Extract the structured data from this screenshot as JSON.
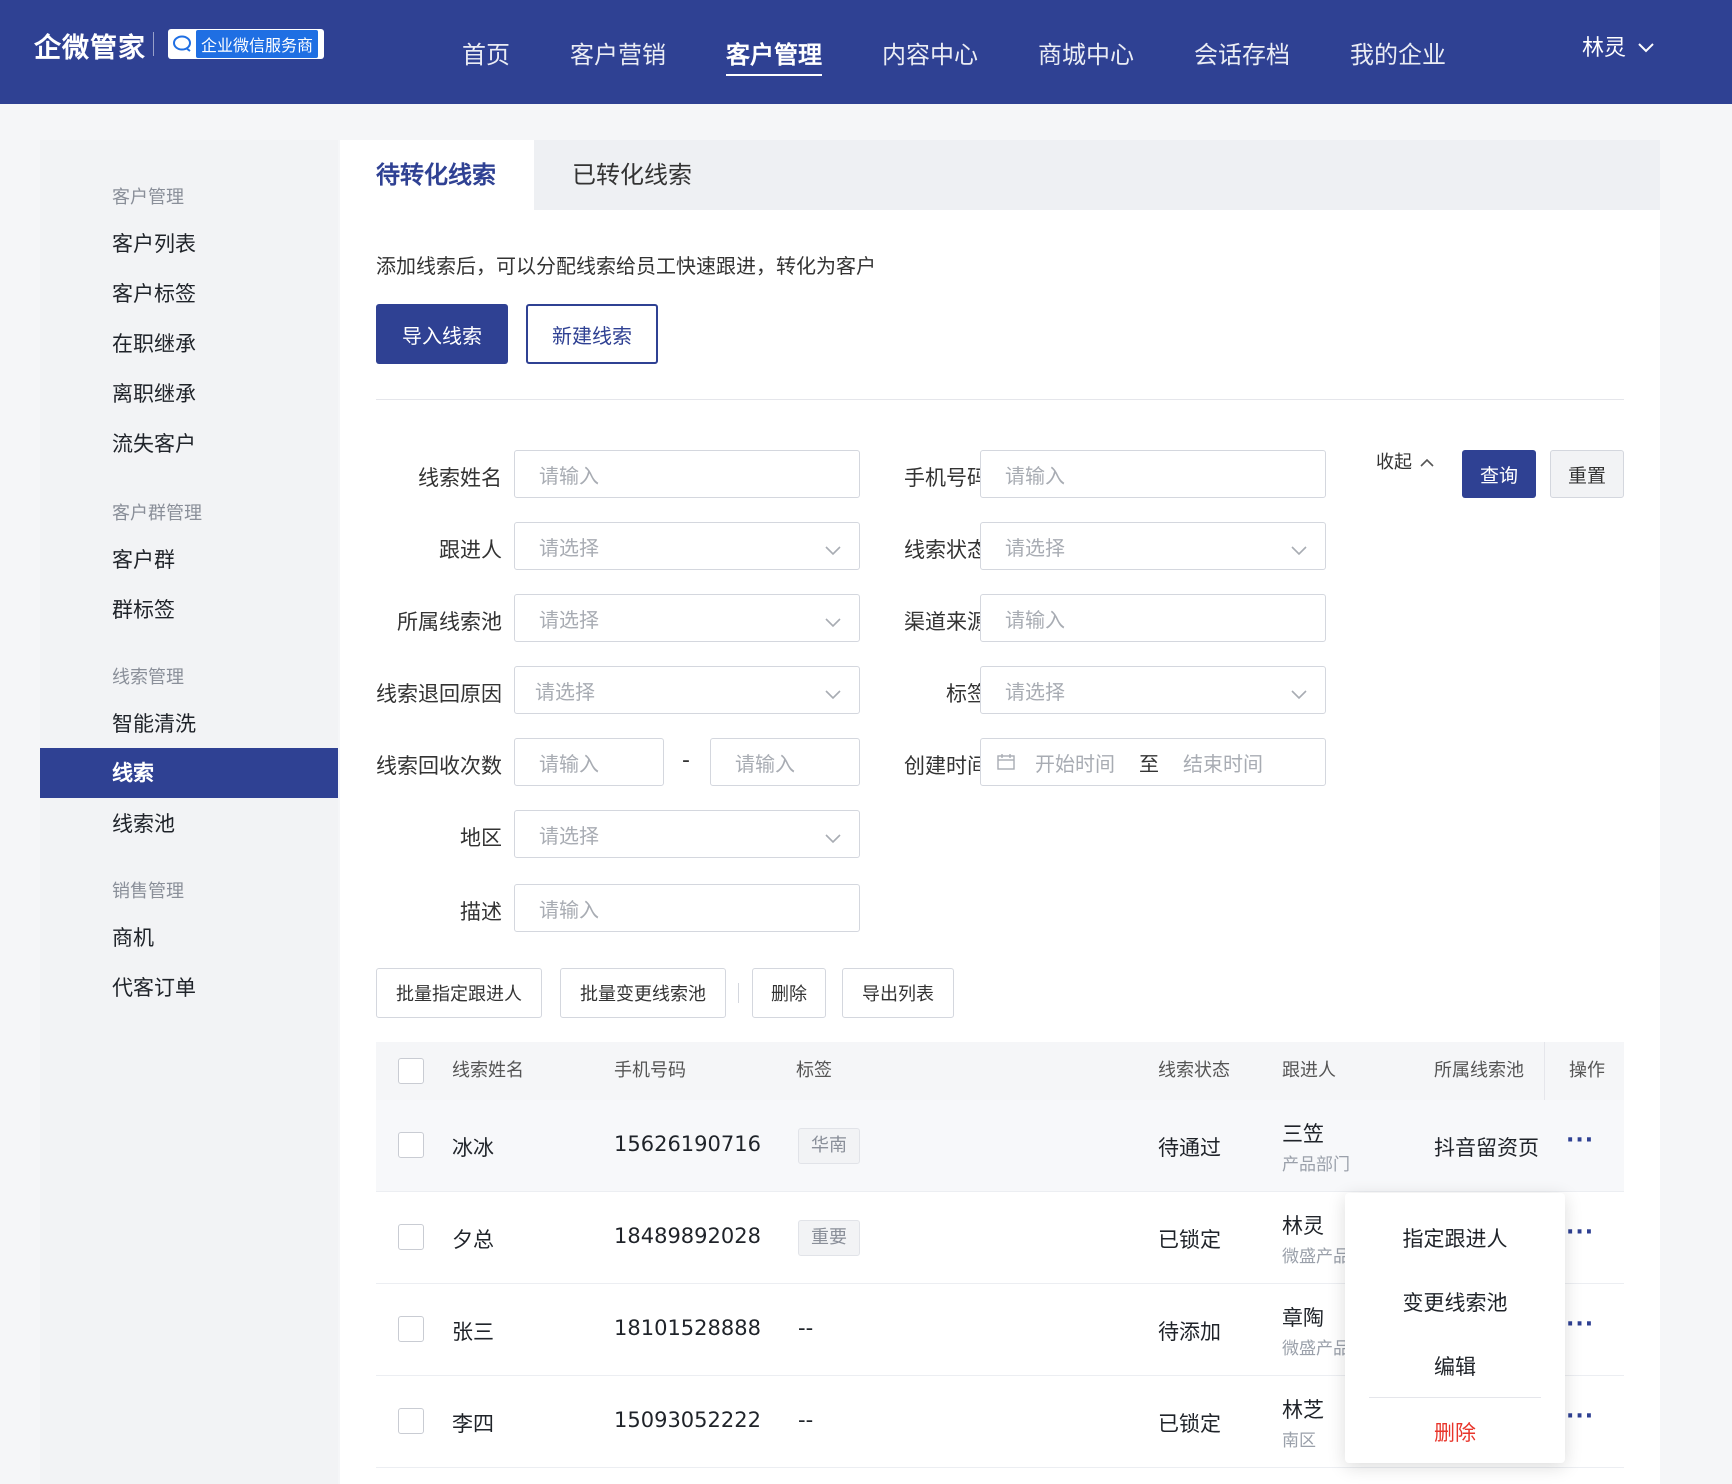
{
  "header": {
    "logo": "企微管家",
    "partner_badge": "企业微信服务商",
    "nav": [
      "首页",
      "客户营销",
      "客户管理",
      "内容中心",
      "商城中心",
      "会话存档",
      "我的企业"
    ],
    "active_nav": "客户管理",
    "user": "林灵"
  },
  "sidebar": {
    "groups": [
      {
        "title": "客户管理",
        "items": [
          "客户列表",
          "客户标签",
          "在职继承",
          "离职继承",
          "流失客户"
        ]
      },
      {
        "title": "客户群管理",
        "items": [
          "客户群",
          "群标签"
        ]
      },
      {
        "title": "线索管理",
        "items": [
          "智能清洗",
          "线索",
          "线索池"
        ]
      },
      {
        "title": "销售管理",
        "items": [
          "商机",
          "代客订单"
        ]
      }
    ],
    "active_item": "线索"
  },
  "tabs": [
    "待转化线索",
    "已转化线索"
  ],
  "description": "添加线索后，可以分配线索给员工快速跟进，转化为客户",
  "buttons": {
    "import": "导入线索",
    "create": "新建线索"
  },
  "filters": {
    "name": {
      "label": "线索姓名",
      "placeholder": "请输入"
    },
    "phone": {
      "label": "手机号码",
      "placeholder": "请输入"
    },
    "follower": {
      "label": "跟进人",
      "placeholder": "请选择"
    },
    "status": {
      "label": "线索状态",
      "placeholder": "请选择"
    },
    "pool": {
      "label": "所属线索池",
      "placeholder": "请选择"
    },
    "channel": {
      "label": "渠道来源",
      "placeholder": "请输入"
    },
    "return_reason": {
      "label": "线索退回原因",
      "placeholder": "请选择"
    },
    "tag": {
      "label": "标签",
      "placeholder": "请选择"
    },
    "recycle_count": {
      "label": "线索回收次数",
      "min_placeholder": "请输入",
      "sep": "-",
      "max_placeholder": "请输入"
    },
    "created": {
      "label": "创建时间",
      "start": "开始时间",
      "to": "至",
      "end": "结束时间"
    },
    "region": {
      "label": "地区",
      "placeholder": "请选择"
    },
    "desc": {
      "label": "描述",
      "placeholder": "请输入"
    },
    "collapse": "收起",
    "query": "查询",
    "reset": "重置"
  },
  "actions": [
    "批量指定跟进人",
    "批量变更线索池",
    "删除",
    "导出列表"
  ],
  "table": {
    "columns": [
      "线索姓名",
      "手机号码",
      "标签",
      "线索状态",
      "跟进人",
      "所属线索池",
      "操作"
    ],
    "rows": [
      {
        "name": "冰冰",
        "phone": "15626190716",
        "tag": "华南",
        "status": "待通过",
        "follower": "三笠",
        "dept": "产品部门",
        "pool": "抖音留资页"
      },
      {
        "name": "夕总",
        "phone": "18489892028",
        "tag": "重要",
        "status": "已锁定",
        "follower": "林灵",
        "dept": "微盛产品",
        "pool": ""
      },
      {
        "name": "张三",
        "phone": "18101528888",
        "tag": "--",
        "status": "待添加",
        "follower": "章陶",
        "dept": "微盛产品",
        "pool": ""
      },
      {
        "name": "李四",
        "phone": "15093052222",
        "tag": "--",
        "status": "已锁定",
        "follower": "林芝",
        "dept": "南区",
        "pool": ""
      }
    ],
    "more": "···"
  },
  "row_menu": [
    "指定跟进人",
    "变更线索池",
    "编辑",
    "删除"
  ],
  "colors": {
    "primary": "#2f4193",
    "danger": "#e8352b"
  }
}
